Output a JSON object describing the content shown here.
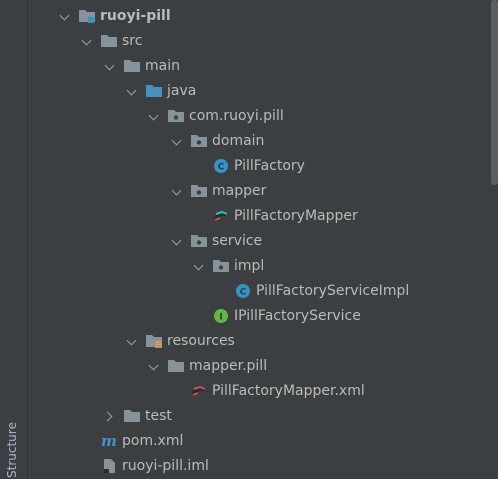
{
  "side_panel": {
    "label": "Structure"
  },
  "tree": {
    "items": [
      {
        "label": "ruoyi-pill"
      },
      {
        "label": "src"
      },
      {
        "label": "main"
      },
      {
        "label": "java"
      },
      {
        "label": "com.ruoyi.pill"
      },
      {
        "label": "domain"
      },
      {
        "label": "PillFactory"
      },
      {
        "label": "mapper"
      },
      {
        "label": "PillFactoryMapper"
      },
      {
        "label": "service"
      },
      {
        "label": "impl"
      },
      {
        "label": "PillFactoryServiceImpl"
      },
      {
        "label": "IPillFactoryService"
      },
      {
        "label": "resources"
      },
      {
        "label": "mapper.pill"
      },
      {
        "label": "PillFactoryMapper.xml"
      },
      {
        "label": "test"
      },
      {
        "label": "pom.xml"
      },
      {
        "label": "ruoyi-pill.iml"
      }
    ]
  },
  "colors": {
    "background": "#3c3f41",
    "text": "#bbbbbb",
    "folder": "#87939a",
    "source_folder": "#4a90c2",
    "class_icon": "#3592c4",
    "interface_icon": "#62b543"
  },
  "icons": {
    "module": "module-folder-icon",
    "folder": "folder-icon",
    "source_folder": "source-folder-icon",
    "package": "package-icon",
    "class": "class-icon",
    "interface": "interface-icon",
    "mybatis_mapper": "mybatis-mapper-icon",
    "resources": "resources-folder-icon",
    "xml_mapper": "xml-mapper-icon",
    "maven": "maven-icon",
    "iml": "iml-file-icon"
  }
}
